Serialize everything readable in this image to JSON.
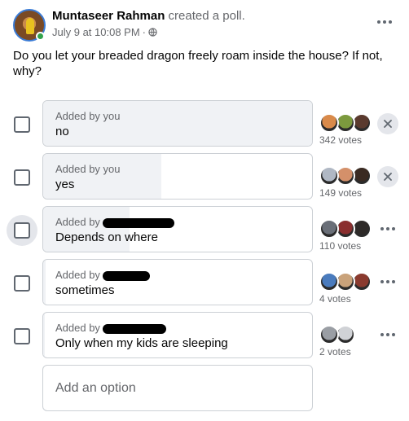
{
  "post": {
    "author": "Muntaseer Rahman",
    "action": "created a poll.",
    "timestamp": "July 9 at 10:08 PM",
    "separator": "·",
    "privacy_icon": "globe-icon",
    "question": "Do you let your breaded dragon freely roam inside the house? If not, why?"
  },
  "poll": {
    "options": [
      {
        "added_by": "Added by you",
        "added_by_redacted": false,
        "label": "no",
        "votes": "342 votes",
        "vote_share": 1.0,
        "action_icon": "close-icon",
        "checked": false
      },
      {
        "added_by": "Added by you",
        "added_by_redacted": false,
        "label": "yes",
        "votes": "149 votes",
        "vote_share": 0.44,
        "action_icon": "close-icon",
        "checked": false
      },
      {
        "added_by": "Added by",
        "added_by_redacted": true,
        "label": "Depends on where",
        "votes": "110 votes",
        "vote_share": 0.32,
        "action_icon": "more-icon",
        "checked": false
      },
      {
        "added_by": "Added by",
        "added_by_redacted": true,
        "label": "sometimes",
        "votes": "4 votes",
        "vote_share": 0.01,
        "action_icon": "more-icon",
        "checked": false
      },
      {
        "added_by": "Added by",
        "added_by_redacted": true,
        "label": "Only when my kids are sleeping",
        "votes": "2 votes",
        "vote_share": 0.006,
        "action_icon": "more-icon",
        "checked": false
      }
    ],
    "add_option_placeholder": "Add an option"
  },
  "colors": {
    "fill": "#f0f2f5",
    "border": "#ccd0d5",
    "muted_text": "#65676b",
    "online": "#31a24c"
  }
}
